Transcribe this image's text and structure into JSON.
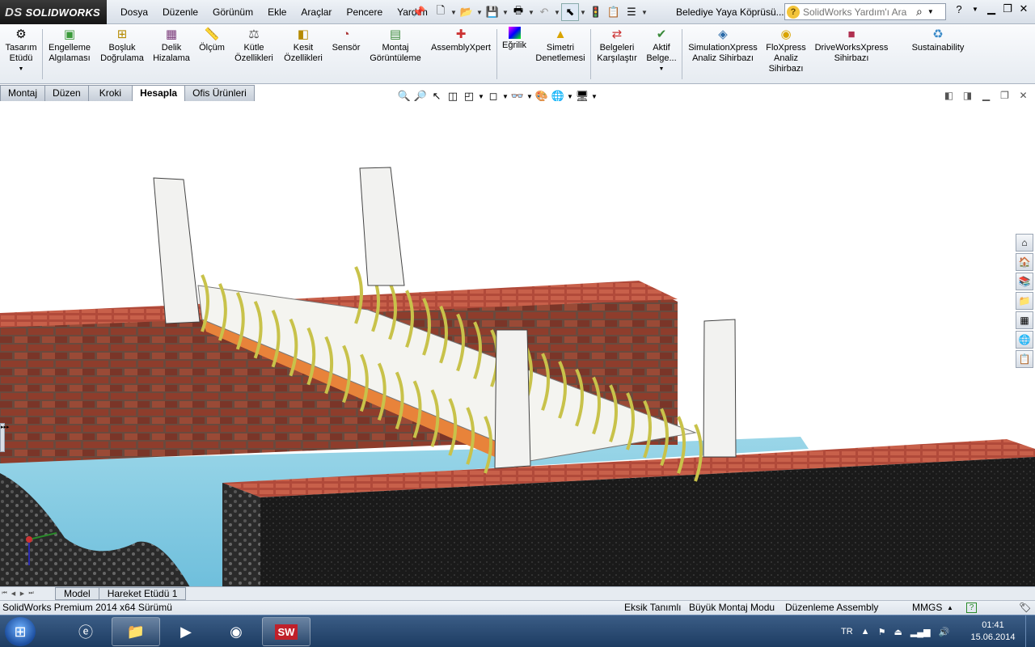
{
  "app": {
    "logo_text": "SOLIDWORKS",
    "logo_mark": "DS"
  },
  "menu": [
    "Dosya",
    "Düzenle",
    "Görünüm",
    "Ekle",
    "Araçlar",
    "Pencere",
    "Yardım"
  ],
  "document_title": "Belediye Yaya Köprüsü....",
  "search": {
    "placeholder": "SolidWorks Yardım'ı Ara"
  },
  "ribbon": [
    {
      "label": "Tasarım\nEtüdü",
      "icon": "design-study-icon"
    },
    {
      "label": "Engelleme\nAlgılaması",
      "icon": "interference-detection-icon"
    },
    {
      "label": "Boşluk\nDoğrulama",
      "icon": "clearance-verification-icon"
    },
    {
      "label": "Delik\nHizalama",
      "icon": "hole-alignment-icon"
    },
    {
      "label": "Ölçüm",
      "icon": "measure-icon"
    },
    {
      "label": "Kütle\nÖzellikleri",
      "icon": "mass-properties-icon"
    },
    {
      "label": "Kesit\nÖzellikleri",
      "icon": "section-properties-icon"
    },
    {
      "label": "Sensör",
      "icon": "sensor-icon"
    },
    {
      "label": "Montaj\nGörüntüleme",
      "icon": "assembly-visualization-icon"
    },
    {
      "label": "AssemblyXpert",
      "icon": "assemblyxpert-icon"
    },
    {
      "label": "Eğrilik",
      "icon": "curvature-icon"
    },
    {
      "label": "Simetri\nDenetlemesi",
      "icon": "symmetry-check-icon"
    },
    {
      "label": "Belgeleri\nKarşılaştır",
      "icon": "compare-documents-icon"
    },
    {
      "label": "Aktif\nBelge...",
      "icon": "check-active-document-icon"
    },
    {
      "label": "SimulationXpress\nAnaliz Sihirbazı",
      "icon": "simulationxpress-icon"
    },
    {
      "label": "FloXpress\nAnaliz\nSihirbazı",
      "icon": "floxpress-icon"
    },
    {
      "label": "DriveWorksXpress\nSihirbazı",
      "icon": "driveworksxpress-icon"
    },
    {
      "label": "Sustainability",
      "icon": "sustainability-icon"
    }
  ],
  "tabs": [
    "Montaj",
    "Düzen",
    "Kroki",
    "Hesapla",
    "Ofis Ürünleri"
  ],
  "active_tab": "Hesapla",
  "bottom_tabs": [
    "Model",
    "Hareket Etüdü 1"
  ],
  "active_bottom_tab": "Model",
  "status": {
    "version": "SolidWorks Premium 2014 x64 Sürümü",
    "definition": "Eksik Tanımlı",
    "mode": "Büyük Montaj Modu",
    "editing": "Düzenleme Assembly",
    "units": "MMGS",
    "units_arrow": "▲"
  },
  "taskbar": {
    "language": "TR",
    "time": "01:41",
    "date": "15.06.2014",
    "apps": [
      "windows-explorer",
      "internet-explorer",
      "file-explorer",
      "media-player",
      "chrome",
      "solidworks"
    ]
  },
  "colors": {
    "brick": "#8a3a2a",
    "water": "#8fd0e4",
    "asphalt": "#1c1c1c",
    "rings": "#c8c24a",
    "accent_blue": "#1d3c62"
  }
}
